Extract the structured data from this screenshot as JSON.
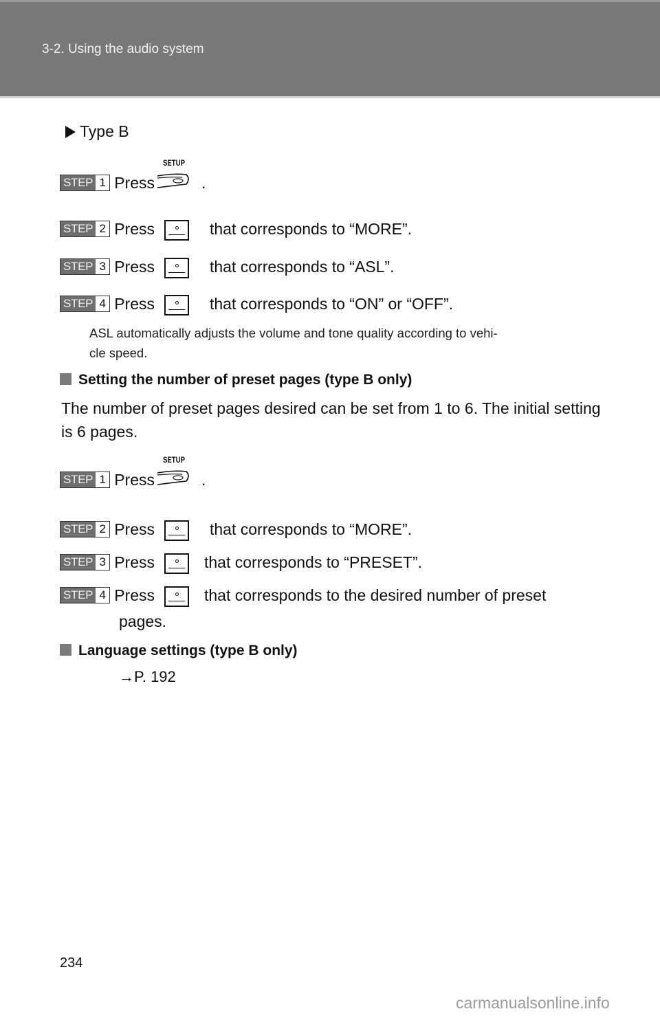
{
  "header": {
    "section_title": "3-2. Using the audio system"
  },
  "type_label": "Type B",
  "steps_asl": [
    {
      "step_label": "STEP",
      "number": "1",
      "press": "Press",
      "icon": "setup-button-icon",
      "icon_caption": "SETUP",
      "suffix": "."
    },
    {
      "step_label": "STEP",
      "number": "2",
      "press": "Press",
      "icon": "preset-button-icon",
      "suffix": "that corresponds to “MORE”."
    },
    {
      "step_label": "STEP",
      "number": "3",
      "press": "Press",
      "icon": "preset-button-icon",
      "suffix": "that corresponds to “ASL”."
    },
    {
      "step_label": "STEP",
      "number": "4",
      "press": "Press",
      "icon": "preset-button-icon",
      "suffix": "that corresponds to “ON” or “OFF”."
    }
  ],
  "asl_note": [
    "ASL automatically adjusts the volume and tone quality according to vehi-",
    "cle speed."
  ],
  "section_preset": {
    "heading": "Setting the number of preset pages (type B only)",
    "description": "The number of preset pages desired can be set from 1 to 6. The initial setting is 6 pages.",
    "steps": [
      {
        "step_label": "STEP",
        "number": "1",
        "press": "Press",
        "icon": "setup-button-icon",
        "icon_caption": "SETUP",
        "suffix": "."
      },
      {
        "step_label": "STEP",
        "number": "2",
        "press": "Press",
        "icon": "preset-button-icon",
        "suffix": "that corresponds to “MORE”."
      },
      {
        "step_label": "STEP",
        "number": "3",
        "press": "Press",
        "icon": "preset-button-icon",
        "suffix": "that corresponds to “PRESET”."
      },
      {
        "step_label": "STEP",
        "number": "4",
        "press": "Press",
        "icon": "preset-button-icon",
        "suffix": "that corresponds to the desired number of preset",
        "continuation": "pages."
      }
    ]
  },
  "section_language": {
    "heading": "Language settings (type B only)",
    "reference": "→P. 192"
  },
  "footer": {
    "page_number": "234",
    "watermark": "carmanualsonline.info"
  }
}
